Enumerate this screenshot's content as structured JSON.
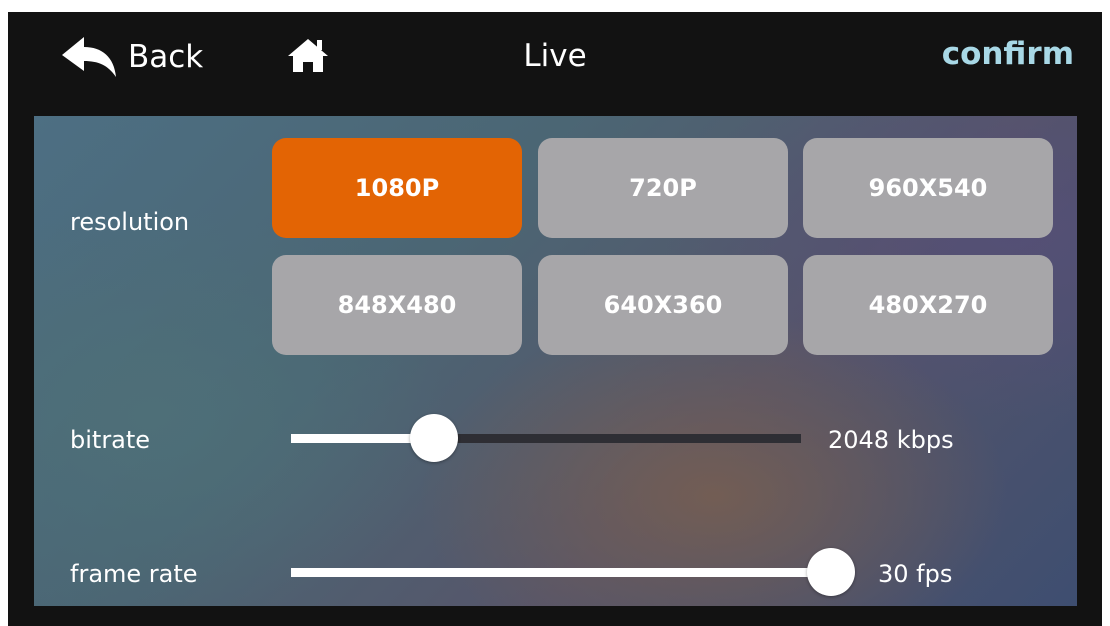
{
  "header": {
    "back_label": "Back",
    "title": "Live",
    "confirm_label": "confirm",
    "confirm_color": "#a8d8e6"
  },
  "icons": {
    "back": "back-arrow-icon",
    "home": "home-icon"
  },
  "resolution": {
    "label": "resolution",
    "selected": "1080P",
    "options": [
      "1080P",
      "720P",
      "960X540",
      "848X480",
      "640X360",
      "480X270"
    ],
    "active_color": "#e36404",
    "inactive_color": "#a7a6a9"
  },
  "bitrate": {
    "label": "bitrate",
    "value_text": "2048 kbps",
    "fraction": 0.28
  },
  "frame_rate": {
    "label": "frame rate",
    "value_text": "30 fps",
    "fraction": 1.0
  }
}
